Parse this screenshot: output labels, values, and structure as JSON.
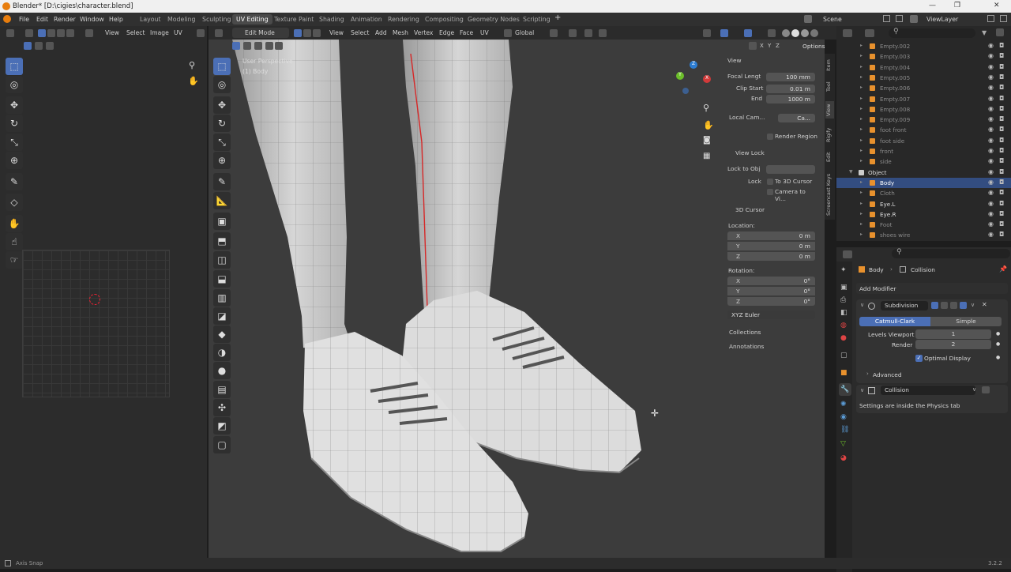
{
  "window": {
    "title": "Blender* [D:\\cigies\\character.blend]",
    "controls": [
      "—",
      "❐",
      "✕"
    ]
  },
  "menus": [
    "File",
    "Edit",
    "Render",
    "Window",
    "Help"
  ],
  "workspaces": [
    "Layout",
    "Modeling",
    "Sculpting",
    "UV Editing",
    "Texture Paint",
    "Shading",
    "Animation",
    "Rendering",
    "Compositing",
    "Geometry Nodes",
    "Scripting"
  ],
  "active_workspace": "UV Editing",
  "add_workspace": "+",
  "scene": "Scene",
  "view_layer": "ViewLayer",
  "uv_header": [
    "View",
    "Select",
    "Image",
    "UV"
  ],
  "vp_header": {
    "mode": "Edit Mode",
    "menus": [
      "View",
      "Select",
      "Add",
      "Mesh",
      "Vertex",
      "Edge",
      "Face",
      "UV"
    ],
    "orientation": "Global",
    "options": "Options",
    "axes": [
      "X",
      "Y",
      "Z"
    ]
  },
  "viewport": {
    "perspective": "User Perspective",
    "object": "(1) Body"
  },
  "gizmo": {
    "x": "X",
    "y": "Y",
    "z": "Z"
  },
  "npanel": {
    "view_header": "View",
    "focal_label": "Focal Lengt",
    "focal_value": "100 mm",
    "clip_start_label": "Clip Start",
    "clip_start_value": "0.01 m",
    "end_label": "End",
    "end_value": "1000 m",
    "local_camera_label": "Local Cam...",
    "local_camera_value": "Ca...",
    "render_region": "Render Region",
    "view_lock_header": "View Lock",
    "lock_to_obj": "Lock to Obj",
    "lock_label": "Lock",
    "to_3d_cursor": "To 3D Cursor",
    "camera_to_view": "Camera to Vi...",
    "cursor_header": "3D Cursor",
    "location_label": "Location:",
    "loc_x": "0 m",
    "loc_y": "0 m",
    "loc_z": "0 m",
    "rotation_label": "Rotation:",
    "rot_x": "0°",
    "rot_y": "0°",
    "rot_z": "0°",
    "rot_mode": "XYZ Euler",
    "collections": "Collections",
    "annotations": "Annotations",
    "axis_x": "X",
    "axis_y": "Y",
    "axis_z": "Z"
  },
  "vtabs": [
    "Item",
    "Tool",
    "View",
    "Rigify",
    "Edit",
    "Screencast Keys"
  ],
  "outliner": {
    "items": [
      "Empty.002",
      "Empty.003",
      "Empty.004",
      "Empty.005",
      "Empty.006",
      "Empty.007",
      "Empty.008",
      "Empty.009",
      "foot front",
      "foot side",
      "front",
      "side",
      "Object",
      "Body",
      "Cloth",
      "Eye.L",
      "Eye.R",
      "Foot",
      "shoes wire"
    ]
  },
  "properties": {
    "breadcrumb_object": "Body",
    "breadcrumb_modifier": "Collision",
    "add_modifier": "Add Modifier",
    "subdivision_name": "Subdivision",
    "catmull": "Catmull-Clark",
    "simple": "Simple",
    "levels_viewport_label": "Levels Viewport",
    "levels_viewport": "1",
    "render_label": "Render",
    "render_value": "2",
    "optimal_display": "Optimal Display",
    "advanced": "Advanced",
    "collision_name": "Collision",
    "collision_note": "Settings are inside the Physics tab"
  },
  "status": {
    "left": "Axis Snap",
    "version": "3.2.2"
  },
  "colors": {
    "accent": "#4b6fb6",
    "seam": "#d62828",
    "selected_row": "#334d80"
  }
}
